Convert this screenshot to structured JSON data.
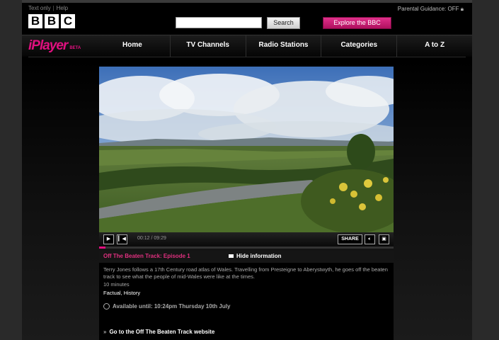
{
  "header": {
    "text_only": "Text only",
    "help": "Help",
    "parental": "Parental Guidance: OFF",
    "logo": [
      "B",
      "B",
      "C"
    ],
    "search_placeholder": "",
    "search_button": "Search",
    "explore_button": "Explore the BBC"
  },
  "nav": {
    "logo_text": "iPlayer",
    "beta": "BETA",
    "items": [
      "Home",
      "TV Channels",
      "Radio Stations",
      "Categories",
      "A to Z"
    ]
  },
  "player": {
    "time": "00:12 / 09:29",
    "share": "SHARE",
    "progress_fraction": 0.021
  },
  "info": {
    "title": "Off The Beaten Track: Episode 1",
    "hide": "Hide information",
    "description": "Terry Jones follows a 17th Century road atlas of Wales. Travelling from Presteigne to Aberystwyth, he goes off the beaten track to see what the people of mid-Wales were like at the times.",
    "duration": "10 minutes",
    "genre": "Factual, History",
    "available": "Available until: 10:24pm Thursday 10th July",
    "site_link": "Go to the Off The Beaten Track website"
  },
  "colors": {
    "accent": "#e0107f",
    "background": "#000000"
  }
}
